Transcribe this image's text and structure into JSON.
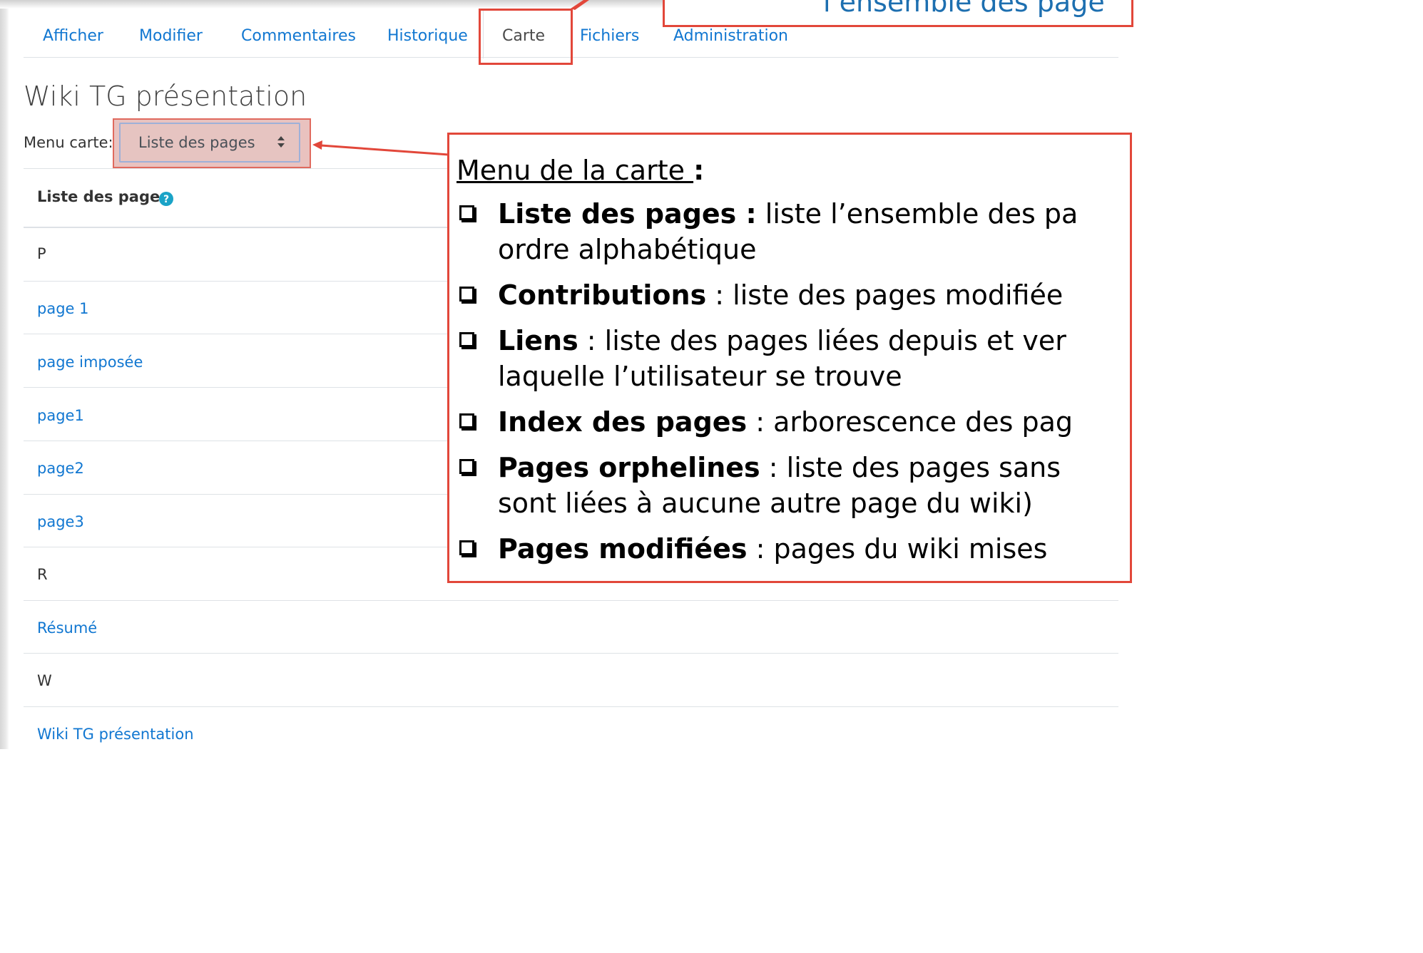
{
  "tabs": [
    {
      "label": "Afficher"
    },
    {
      "label": "Modifier"
    },
    {
      "label": "Commentaires"
    },
    {
      "label": "Historique"
    },
    {
      "label": "Carte"
    },
    {
      "label": "Fichiers"
    },
    {
      "label": "Administration"
    }
  ],
  "page_title": "Wiki TG présentation",
  "menu": {
    "label": "Menu carte:",
    "selected": "Liste des pages"
  },
  "list": {
    "header": "Liste des pages",
    "rows": [
      {
        "text": "P",
        "type": "letter"
      },
      {
        "text": "page 1",
        "type": "link"
      },
      {
        "text": "page imposée",
        "type": "link"
      },
      {
        "text": "page1",
        "type": "link"
      },
      {
        "text": "page2",
        "type": "link"
      },
      {
        "text": "page3",
        "type": "link"
      },
      {
        "text": "R",
        "type": "letter"
      },
      {
        "text": "Résumé",
        "type": "link"
      },
      {
        "text": "W",
        "type": "letter"
      },
      {
        "text": "Wiki TG présentation",
        "type": "link"
      }
    ]
  },
  "annotation_top": {
    "text": "l’ensemble des page"
  },
  "annotation": {
    "title": "Menu de la carte ",
    "title_colon": ":",
    "bullets": [
      {
        "term": "Liste des pages :",
        "line1": " liste l’ensemble des pa",
        "line2": "ordre alphabétique"
      },
      {
        "term": "Contributions",
        "line1": " : liste des pages modifiée",
        "line2": ""
      },
      {
        "term": "Liens",
        "line1": " : liste des pages liées depuis et ver",
        "line2": "laquelle l’utilisateur se trouve"
      },
      {
        "term": "Index des pages",
        "line1": " : arborescence des pag",
        "line2": ""
      },
      {
        "term": "Pages orphelines",
        "line1": " : liste des pages sans",
        "line2": "sont liées à aucune autre page du wiki)"
      },
      {
        "term": "Pages modifiées",
        "line1": " : pages du wiki mises ",
        "line2": ""
      }
    ]
  },
  "colors": {
    "link": "#1177d1",
    "annotation_border": "#e2473a",
    "annotation_top_text": "#1d6fb0"
  }
}
